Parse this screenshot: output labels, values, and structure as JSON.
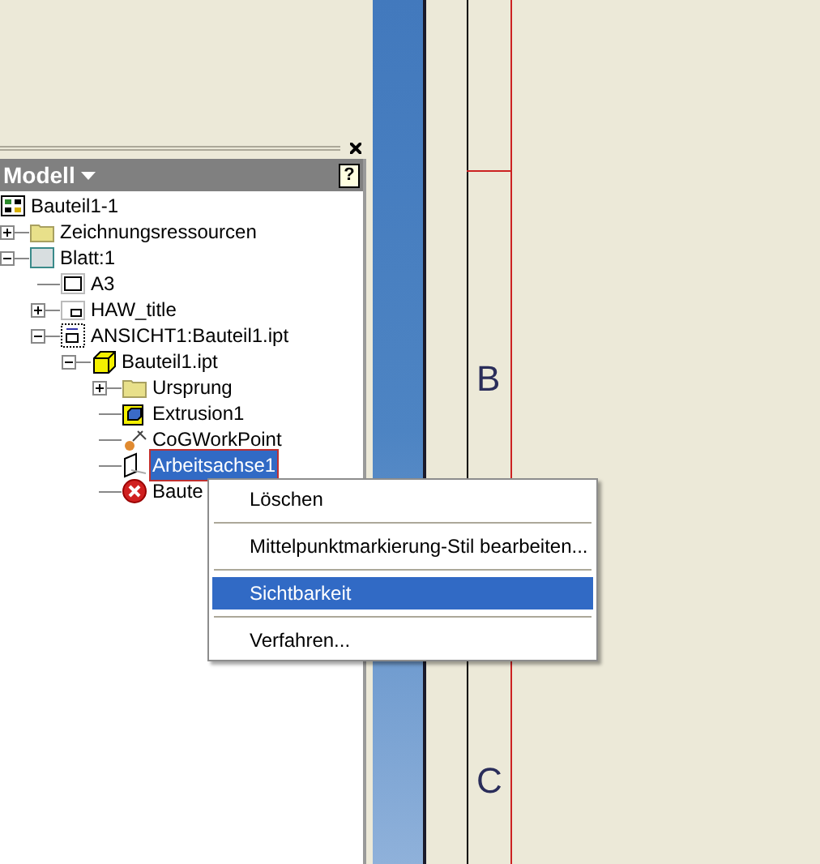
{
  "panel": {
    "title": "Modell",
    "help_button": "?"
  },
  "tree": [
    {
      "label": "Bauteil1-1",
      "kind": "part-root",
      "selected": false,
      "children": [
        {
          "label": "Zeichnungsressourcen",
          "kind": "folder",
          "expanded": false,
          "selected": false
        },
        {
          "label": "Blatt:1",
          "kind": "sheet",
          "expanded": true,
          "selected": false,
          "children": [
            {
              "label": "A3",
              "kind": "frame",
              "selected": false
            },
            {
              "label": "HAW_title",
              "kind": "titleblock",
              "expanded": false,
              "selected": false
            },
            {
              "label": "ANSICHT1:Bauteil1.ipt",
              "kind": "view",
              "expanded": true,
              "selected": false,
              "children": [
                {
                  "label": "Bauteil1.ipt",
                  "kind": "part",
                  "expanded": true,
                  "selected": false,
                  "children": [
                    {
                      "label": "Ursprung",
                      "kind": "folder",
                      "expanded": false,
                      "selected": false
                    },
                    {
                      "label": "Extrusion1",
                      "kind": "extrusion",
                      "selected": false
                    },
                    {
                      "label": "CoGWorkPoint",
                      "kind": "workpoint",
                      "selected": false
                    },
                    {
                      "label": "Arbeitsachse1",
                      "kind": "axis",
                      "selected": true
                    },
                    {
                      "label": "Baute",
                      "kind": "error",
                      "selected": false
                    }
                  ]
                }
              ]
            }
          ]
        }
      ]
    }
  ],
  "context_menu": [
    {
      "label": "Löschen",
      "selected": false
    },
    {
      "label": "Mittelpunktmarkierung-Stil bearbeiten...",
      "selected": false
    },
    {
      "label": "Sichtbarkeit",
      "selected": true
    },
    {
      "label": "Verfahren...",
      "selected": false
    }
  ],
  "sheet": {
    "zone_labels": [
      "B",
      "C"
    ]
  }
}
